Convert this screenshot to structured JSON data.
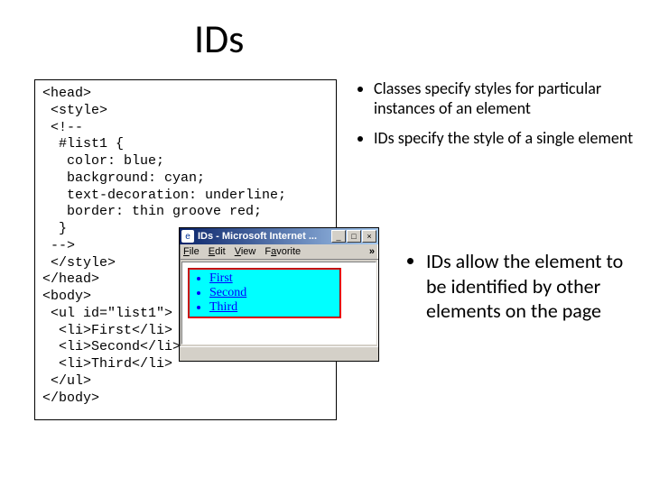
{
  "title": "IDs",
  "code": "<head>\n <style>\n <!--\n  #list1 {\n   color: blue;\n   background: cyan;\n   text-decoration: underline;\n   border: thin groove red;\n  }\n -->\n </style>\n</head>\n<body>\n <ul id=\"list1\">\n  <li>First</li>\n  <li>Second</li>\n  <li>Third</li>\n </ul>\n</body>",
  "bullets": {
    "items": [
      "Classes specify styles for particular instances of an element",
      "IDs specify the style of a single element"
    ],
    "sub": "IDs allow the element to be identified by other elements on the page"
  },
  "browser": {
    "title": "IDs - Microsoft Internet ...",
    "menu": {
      "file": "File",
      "edit": "Edit",
      "view": "View",
      "favorite": "Favorite",
      "more": "»"
    },
    "buttons": {
      "min": "_",
      "max": "□",
      "close": "×"
    },
    "list": [
      "First",
      "Second",
      "Third"
    ]
  }
}
